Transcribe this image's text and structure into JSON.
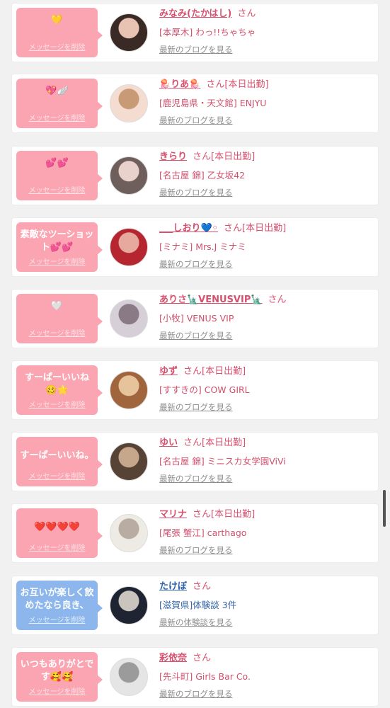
{
  "delete_label": "メッセージを削除",
  "entries": [
    {
      "message": "💛",
      "name": "みなみ(たかはし)",
      "san": "さん",
      "status": "",
      "shop": "[本厚木] わっ!!ちゃちゃ",
      "link": "最新のブログを見る",
      "bubble_color": "pink",
      "avatar_colors": [
        "#3a2a26",
        "#e8c3b4"
      ]
    },
    {
      "message": "💖🪽",
      "name": "🪼りあ🪼",
      "san": "さん",
      "status": "[本日出勤]",
      "shop": "[鹿児島県・天文館] ENJYU",
      "link": "最新のブログを見る",
      "bubble_color": "pink",
      "avatar_colors": [
        "#f4ddd0",
        "#c89a76"
      ]
    },
    {
      "message": "💕💕",
      "name": "きらり",
      "san": "さん",
      "status": "[本日出勤]",
      "shop": "[名古屋 錦] 乙女坂42",
      "link": "最新のブログを見る",
      "bubble_color": "pink",
      "avatar_colors": [
        "#6e5f5c",
        "#e9d2cb"
      ]
    },
    {
      "message": "素敵なツーショット💕💕",
      "name": "___しおり💙◦",
      "san": "さん",
      "status": "[本日出勤]",
      "shop": "[ミナミ] Mrs.J ミナミ",
      "link": "最新のブログを見る",
      "bubble_color": "pink",
      "avatar_colors": [
        "#b52630",
        "#e7a89d"
      ]
    },
    {
      "message": "🤍",
      "name": "ありさ🗽VENUSVIP🗽",
      "san": "さん",
      "status": "",
      "shop": "[小牧] VENUS VIP",
      "link": "最新のブログを見る",
      "bubble_color": "pink",
      "avatar_colors": [
        "#d6cfd7",
        "#8a7a86"
      ]
    },
    {
      "message": "すーぱーいいね🥴🌟",
      "name": "ゆず",
      "san": "さん",
      "status": "[本日出勤]",
      "shop": "[すすきの] COW GIRL",
      "link": "最新のブログを見る",
      "bubble_color": "pink",
      "avatar_colors": [
        "#a0653d",
        "#e7c39c"
      ]
    },
    {
      "message": "すーぱーいいね。",
      "name": "ゆい",
      "san": "さん",
      "status": "[本日出勤]",
      "shop": "[名古屋 錦] ミニスカ女学園ViVi",
      "link": "最新のブログを見る",
      "bubble_color": "pink",
      "avatar_colors": [
        "#574236",
        "#c7a78c"
      ]
    },
    {
      "message": "❤️❤️❤️❤️",
      "name": "マリナ",
      "san": "さん",
      "status": "[本日出勤]",
      "shop": "[尾張 蟹江] carthago",
      "link": "最新のブログを見る",
      "bubble_color": "pink",
      "avatar_colors": [
        "#eeeae4",
        "#b9aca2"
      ]
    },
    {
      "message": "お互いが楽しく飲めたなら良き、",
      "name": "たけぼ",
      "san": "さん",
      "status": "",
      "shop": "[滋賀県]体験談 3件",
      "link": "最新の体験談を見る",
      "bubble_color": "blue",
      "avatar_colors": [
        "#1f2433",
        "#c9c4bd"
      ]
    },
    {
      "message": "いつもありがとです🥰🥰",
      "name": "彩依奈",
      "san": "さん",
      "status": "",
      "shop": "[先斗町] Girls Bar Co.",
      "link": "最新のブログを見る",
      "bubble_color": "pink",
      "avatar_colors": [
        "#e5e5e5",
        "#9b9b9b"
      ]
    }
  ]
}
